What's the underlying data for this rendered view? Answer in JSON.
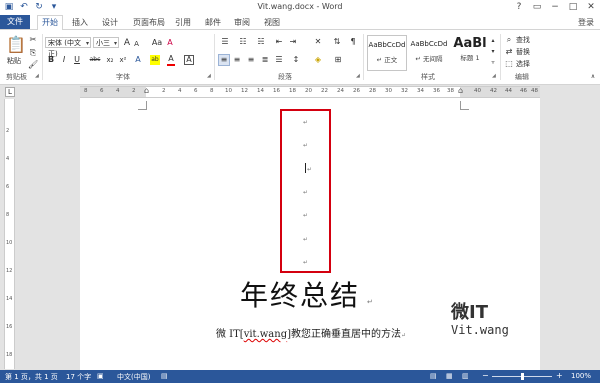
{
  "window": {
    "title": "Vit.wang.docx - Word",
    "signin": "登录"
  },
  "qat": {
    "save_icon": "save-icon",
    "undo_icon": "undo-icon",
    "redo_icon": "redo-icon"
  },
  "tabs": [
    {
      "label": "文件"
    },
    {
      "label": "开始"
    },
    {
      "label": "插入"
    },
    {
      "label": "设计"
    },
    {
      "label": "页面布局"
    },
    {
      "label": "引用"
    },
    {
      "label": "邮件"
    },
    {
      "label": "审阅"
    },
    {
      "label": "视图"
    }
  ],
  "ribbon": {
    "clipboard": {
      "label": "剪贴板",
      "paste": "粘贴"
    },
    "font": {
      "label": "字体",
      "font_name": "宋体 (中文正)",
      "font_size": "小三",
      "bold": "B",
      "italic": "I",
      "underline": "U",
      "strike": "abc",
      "sub": "x₂",
      "sup": "x²",
      "grow": "A",
      "shrink": "A",
      "case": "Aa",
      "clear": "A",
      "highlight": "ab",
      "color": "A",
      "border": "A"
    },
    "paragraph": {
      "label": "段落"
    },
    "styles": {
      "label": "样式",
      "items": [
        {
          "preview": "AaBbCcDd",
          "name": "↵ 正文"
        },
        {
          "preview": "AaBbCcDd",
          "name": "↵ 无间隔"
        },
        {
          "preview": "AaBl",
          "name": "标题 1"
        }
      ]
    },
    "editing": {
      "label": "编辑",
      "find": "查找",
      "replace": "替换",
      "select": "选择"
    }
  },
  "ruler": {
    "h_left": [
      "8",
      "6",
      "4",
      "2"
    ],
    "h_right": [
      "2",
      "4",
      "6",
      "8",
      "10",
      "12",
      "14",
      "16",
      "18",
      "20",
      "22",
      "24",
      "26",
      "28",
      "30",
      "32",
      "34",
      "36",
      "38",
      "40",
      "42",
      "44",
      "46",
      "48"
    ],
    "v_numbers": [
      "2",
      "4",
      "6",
      "8",
      "10",
      "12",
      "14",
      "16",
      "18"
    ],
    "tab_selector": "L"
  },
  "document": {
    "para_mark": "↵",
    "title": "年终总结",
    "subtitle_pre": "微 IT[",
    "subtitle_err": "vit.wang",
    "subtitle_post": "]教您正确垂直居中的方法",
    "logo_line1": "微IT",
    "logo_line2": "Vit.wang"
  },
  "status": {
    "page": "第 1 页，共 1 页",
    "words": "17 个字",
    "lang": "中文(中国)",
    "zoom": "100%",
    "zoom_level": 0.5,
    "minus": "−",
    "plus": "+"
  }
}
